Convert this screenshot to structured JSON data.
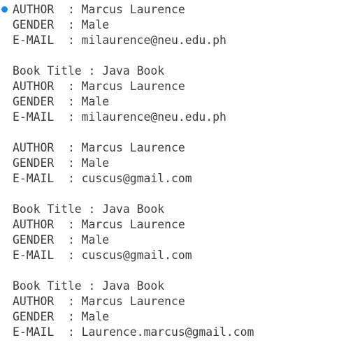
{
  "console": {
    "marker_color": "#1e88e5",
    "lines": [
      "AUTHOR  : Marcus Laurence",
      "GENDER  : Male",
      "E-MAIL  : milaurence@neu.edu.ph",
      "",
      "Book Title : Java Book",
      "AUTHOR  : Marcus Laurence",
      "GENDER  : Male",
      "E-MAIL  : milaurence@neu.edu.ph",
      "",
      "AUTHOR  : Marcus Laurence",
      "GENDER  : Male",
      "E-MAIL  : cuscus@gmail.com",
      "",
      "Book Title : Java Book",
      "AUTHOR  : Marcus Laurence",
      "GENDER  : Male",
      "E-MAIL  : cuscus@gmail.com",
      "",
      "Book Title : Java Book",
      "AUTHOR  : Marcus Laurence",
      "GENDER  : Male",
      "E-MAIL  : Laurence.marcus@gmail.com"
    ]
  }
}
